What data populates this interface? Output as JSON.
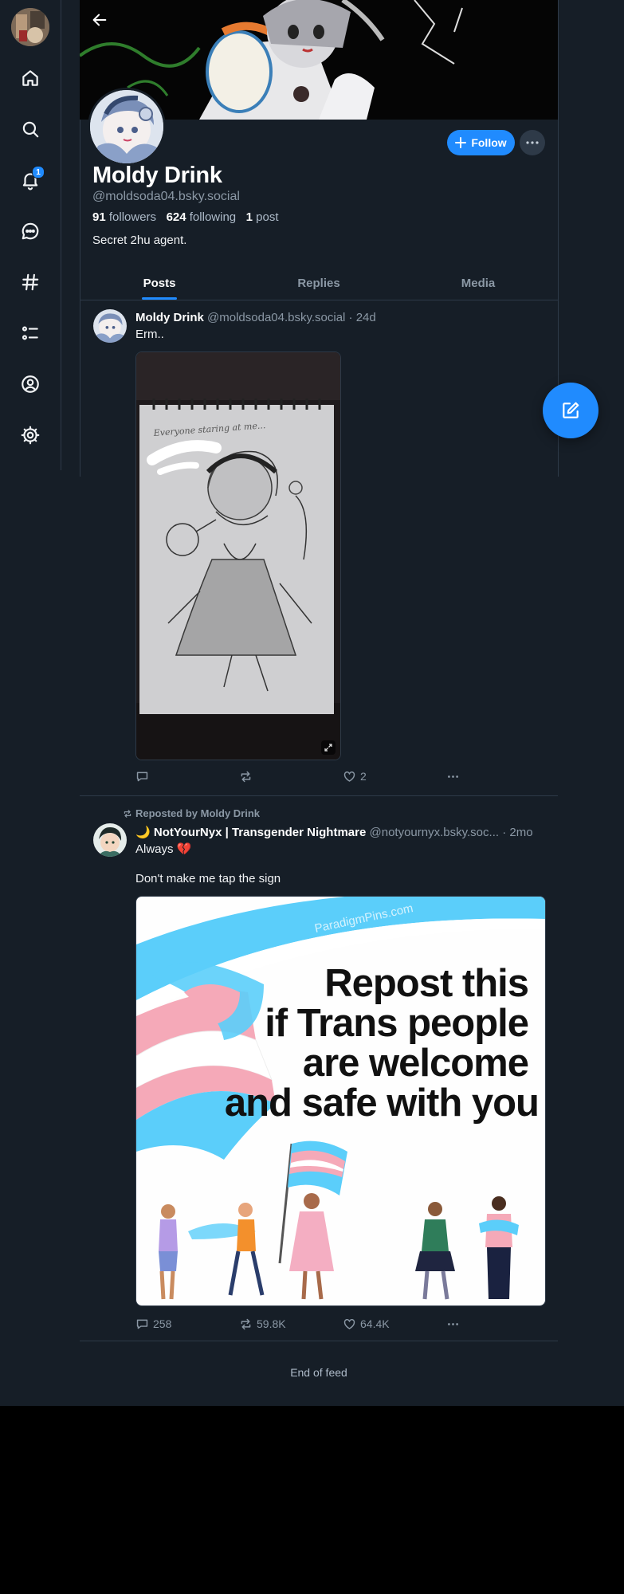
{
  "notifications": {
    "badge": "1"
  },
  "profile": {
    "display_name": "Moldy Drink",
    "handle": "@moldsoda04.bsky.social",
    "followers_count": "91",
    "followers_label": "followers",
    "following_count": "624",
    "following_label": "following",
    "posts_count": "1",
    "posts_label": "post",
    "bio": "Secret 2hu agent.",
    "follow_label": "Follow"
  },
  "tabs": [
    {
      "label": "Posts",
      "active": true
    },
    {
      "label": "Replies",
      "active": false
    },
    {
      "label": "Media",
      "active": false
    }
  ],
  "posts": [
    {
      "author": "Moldy Drink",
      "handle_time": "@moldsoda04.bsky.social · 24d",
      "text": "Erm..",
      "image_text": "Everyone staring at me...",
      "likes": "2"
    },
    {
      "repost_label": "Reposted by Moldy Drink",
      "author": "NotYourNyx | Transgender Nightmare",
      "author_emoji": "🌙",
      "handle_time": "@notyournyx.bsky.soc... · 2mo",
      "text_line1": "Always",
      "text_emoji": "💔",
      "text_line2": "Don't make me tap the sign",
      "image_watermark": "ParadigmPins.com",
      "image_lines": [
        "Repost this",
        "if Trans people",
        "are welcome",
        "and safe with you"
      ],
      "replies": "258",
      "reposts": "59.8K",
      "likes": "64.4K"
    }
  ],
  "feed_end": "End of feed",
  "colors": {
    "accent": "#208bfe",
    "background": "#161e27",
    "border": "#2e3a48",
    "muted": "#8b98a5"
  }
}
